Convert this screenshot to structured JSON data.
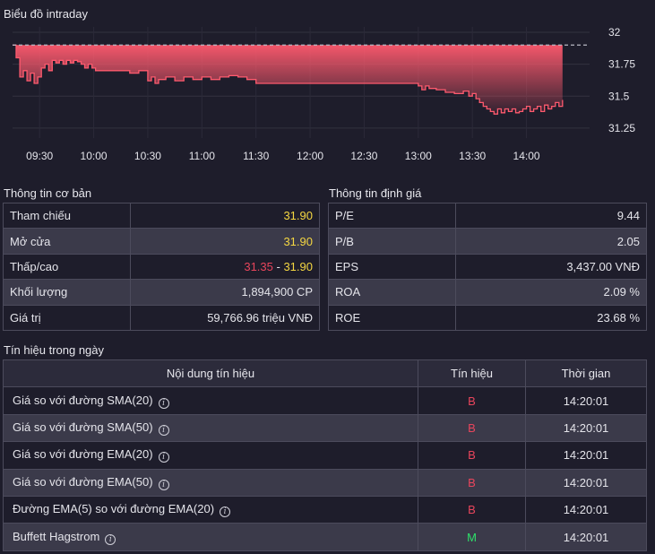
{
  "chart_title": "Biểu đồ intraday",
  "chart_data": {
    "type": "area",
    "ylim": [
      31.2,
      32.0
    ],
    "y_ticks": [
      "32",
      "31.75",
      "31.5",
      "31.25"
    ],
    "x_ticks": [
      "09:30",
      "10:00",
      "10:30",
      "11:00",
      "11:30",
      "12:00",
      "12:30",
      "13:00",
      "13:30",
      "14:00"
    ],
    "reference": 31.9,
    "colors": {
      "line": "#ff5a6e",
      "area_top": "#ff5a6e",
      "reference": "#b8b8c4"
    },
    "x": [
      "09:15",
      "09:17",
      "09:19",
      "09:21",
      "09:23",
      "09:25",
      "09:27",
      "09:29",
      "09:31",
      "09:33",
      "09:35",
      "09:37",
      "09:39",
      "09:41",
      "09:43",
      "09:45",
      "09:47",
      "09:49",
      "09:51",
      "09:53",
      "09:55",
      "09:57",
      "09:59",
      "10:01",
      "10:05",
      "10:10",
      "10:15",
      "10:20",
      "10:25",
      "10:30",
      "10:32",
      "10:34",
      "10:36",
      "10:40",
      "10:45",
      "10:50",
      "10:55",
      "11:00",
      "11:05",
      "11:10",
      "11:15",
      "11:20",
      "11:25",
      "11:30",
      "11:35",
      "11:45",
      "12:00",
      "12:15",
      "12:30",
      "12:45",
      "13:00",
      "13:02",
      "13:04",
      "13:06",
      "13:10",
      "13:15",
      "13:20",
      "13:25",
      "13:28",
      "13:30",
      "13:32",
      "13:34",
      "13:36",
      "13:38",
      "13:40",
      "13:42",
      "13:44",
      "13:46",
      "13:48",
      "13:50",
      "13:52",
      "13:54",
      "13:56",
      "13:58",
      "14:00",
      "14:02",
      "14:04",
      "14:06",
      "14:08",
      "14:10",
      "14:12",
      "14:14",
      "14:16",
      "14:18",
      "14:20"
    ],
    "y": [
      31.9,
      31.8,
      31.65,
      31.7,
      31.62,
      31.68,
      31.6,
      31.65,
      31.72,
      31.75,
      31.7,
      31.78,
      31.76,
      31.78,
      31.75,
      31.78,
      31.76,
      31.78,
      31.77,
      31.75,
      31.72,
      31.75,
      31.72,
      31.7,
      31.7,
      31.7,
      31.7,
      31.68,
      31.7,
      31.62,
      31.65,
      31.6,
      31.63,
      31.65,
      31.62,
      31.65,
      31.63,
      31.65,
      31.63,
      31.65,
      31.66,
      31.65,
      31.63,
      31.6,
      31.6,
      31.6,
      31.6,
      31.6,
      31.6,
      31.6,
      31.58,
      31.55,
      31.58,
      31.56,
      31.55,
      31.53,
      31.52,
      31.54,
      31.5,
      31.52,
      31.48,
      31.45,
      31.42,
      31.4,
      31.38,
      31.36,
      31.4,
      31.37,
      31.4,
      31.38,
      31.4,
      31.37,
      31.38,
      31.4,
      31.42,
      31.38,
      31.4,
      31.42,
      31.38,
      31.43,
      31.4,
      31.42,
      31.45,
      31.42,
      31.47
    ]
  },
  "basic": {
    "title": "Thông tin cơ bản",
    "rows": [
      {
        "label": "Tham chiếu",
        "value": "31.90"
      },
      {
        "label": "Mở cửa",
        "value": "31.90"
      },
      {
        "label": "Thấp/cao",
        "low": "31.35",
        "sep": " - ",
        "high": "31.90"
      },
      {
        "label": "Khối lượng",
        "value": "1,894,900 CP"
      },
      {
        "label": "Giá trị",
        "value": "59,766.96 triệu VNĐ"
      }
    ]
  },
  "valuation": {
    "title": "Thông tin định giá",
    "rows": [
      {
        "label": "P/E",
        "value": "9.44"
      },
      {
        "label": "P/B",
        "value": "2.05"
      },
      {
        "label": "EPS",
        "value": "3,437.00 VNĐ"
      },
      {
        "label": "ROA",
        "value": "2.09 %"
      },
      {
        "label": "ROE",
        "value": "23.68 %"
      }
    ]
  },
  "signals": {
    "title": "Tín hiệu trong ngày",
    "headers": [
      "Nội dung tín hiệu",
      "Tín hiệu",
      "Thời gian"
    ],
    "info_glyph": "i",
    "rows": [
      {
        "content": "Giá so với đường SMA(20)",
        "signal": "B",
        "time": "14:20:01"
      },
      {
        "content": "Giá so với đường SMA(50)",
        "signal": "B",
        "time": "14:20:01"
      },
      {
        "content": "Giá so với đường EMA(20)",
        "signal": "B",
        "time": "14:20:01"
      },
      {
        "content": "Giá so với đường EMA(50)",
        "signal": "B",
        "time": "14:20:01"
      },
      {
        "content": "Đường EMA(5) so với đường EMA(20)",
        "signal": "B",
        "time": "14:20:01"
      },
      {
        "content": "Buffett Hagstrom",
        "signal": "M",
        "time": "14:20:01"
      }
    ]
  }
}
